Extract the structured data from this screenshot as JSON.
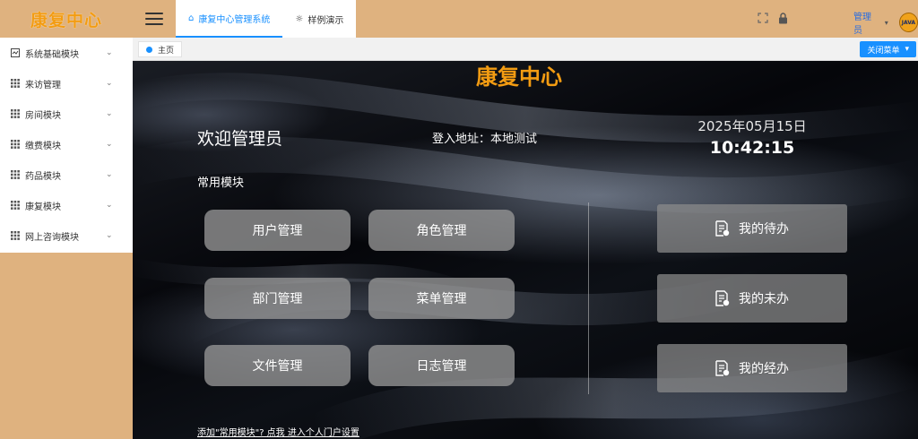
{
  "brand": {
    "name": "康复中心",
    "color": "#f39c12"
  },
  "sidebar": {
    "items": [
      {
        "label": "系统基础模块",
        "icon": "system-icon"
      },
      {
        "label": "来访管理",
        "icon": "grid-icon"
      },
      {
        "label": "房间模块",
        "icon": "grid-icon"
      },
      {
        "label": "缴费模块",
        "icon": "grid-icon"
      },
      {
        "label": "药品模块",
        "icon": "grid-icon"
      },
      {
        "label": "康复模块",
        "icon": "grid-icon"
      },
      {
        "label": "网上咨询模块",
        "icon": "grid-icon"
      }
    ]
  },
  "topbar": {
    "tabs": [
      {
        "label": "康复中心管理系统",
        "icon": "home-icon",
        "active": true
      },
      {
        "label": "样例演示",
        "icon": "bulb-icon",
        "active": false
      }
    ],
    "user": {
      "name": "管理员",
      "avatar_text": "JAVA"
    }
  },
  "tabstrip": {
    "page_tab": "主页",
    "close_menu": "关闭菜单"
  },
  "main": {
    "welcome": "欢迎管理员",
    "login_address": "登入地址：本地测试",
    "date": "2025年05月15日",
    "time": "10:42:15",
    "common_title": "常用模块",
    "modules": [
      "用户管理",
      "角色管理",
      "部门管理",
      "菜单管理",
      "文件管理",
      "日志管理"
    ],
    "tasks": [
      "我的待办",
      "我的未办",
      "我的经办"
    ],
    "footer": "添加\"常用模块\"? 点我 进入个人门户设置"
  },
  "colors": {
    "accent": "#1890ff",
    "header": "#dfb27f"
  }
}
